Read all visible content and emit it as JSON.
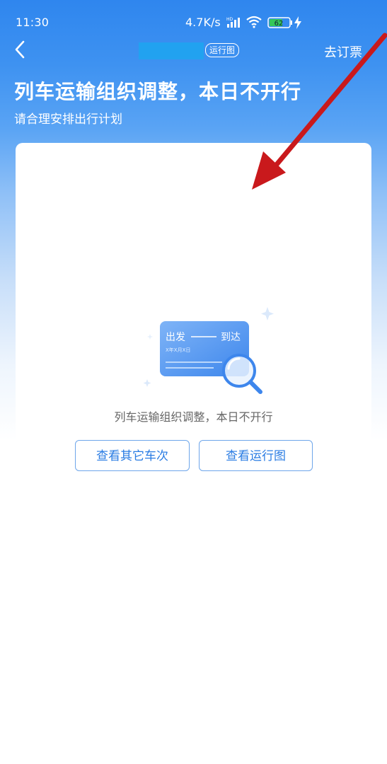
{
  "status_bar": {
    "time": "11:30",
    "net_speed": "4.7K/s",
    "signal_badge": "HD",
    "battery_level": "62",
    "icons": [
      "signal-icon",
      "wifi-icon",
      "battery-icon",
      "charging-icon"
    ]
  },
  "nav": {
    "map_tag": "运行图",
    "book_label": "去订票"
  },
  "header": {
    "headline": "列车运输组织调整，本日不开行",
    "subline": "请合理安排出行计划"
  },
  "illustration": {
    "depart": "出发",
    "arrive": "到达",
    "date_placeholder": "X年X月X日"
  },
  "main": {
    "empty_message": "列车运输组织调整，本日不开行",
    "buttons": {
      "other_trains": "查看其它车次",
      "view_map": "查看运行图"
    }
  },
  "colors": {
    "primary_blue": "#2f86ee",
    "button_text": "#2a7ce3",
    "annotation_arrow": "#c9191c"
  }
}
